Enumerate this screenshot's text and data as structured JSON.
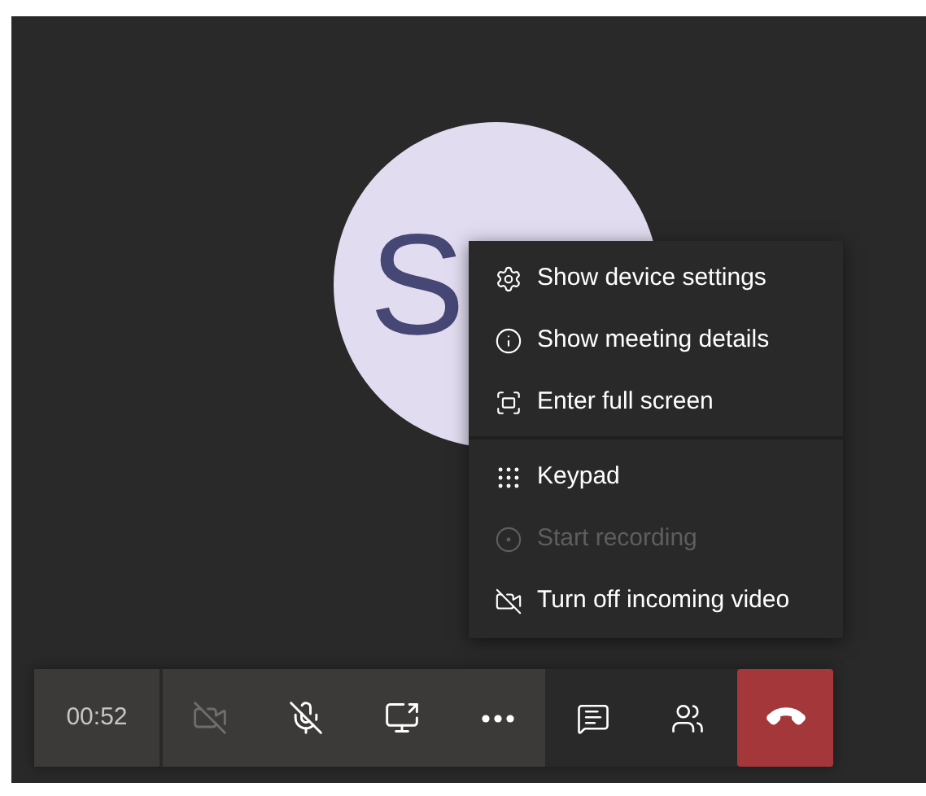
{
  "avatar": {
    "initial": "S"
  },
  "menu": {
    "groups": [
      [
        {
          "kind": "settings",
          "label": "Show device settings",
          "disabled": false
        },
        {
          "kind": "info",
          "label": "Show meeting details",
          "disabled": false
        },
        {
          "kind": "fullscreen",
          "label": "Enter full screen",
          "disabled": false
        }
      ],
      [
        {
          "kind": "keypad",
          "label": "Keypad",
          "disabled": false
        },
        {
          "kind": "record",
          "label": "Start recording",
          "disabled": true
        },
        {
          "kind": "video-off",
          "label": "Turn off incoming video",
          "disabled": false
        }
      ]
    ]
  },
  "toolbar": {
    "timer": "00:52",
    "buttons": [
      {
        "kind": "camera-off",
        "disabled": true
      },
      {
        "kind": "mic-off",
        "disabled": false
      },
      {
        "kind": "share",
        "disabled": false
      },
      {
        "kind": "more",
        "disabled": false
      }
    ],
    "side_buttons": [
      {
        "kind": "chat"
      },
      {
        "kind": "people"
      },
      {
        "kind": "hang-up"
      }
    ]
  }
}
